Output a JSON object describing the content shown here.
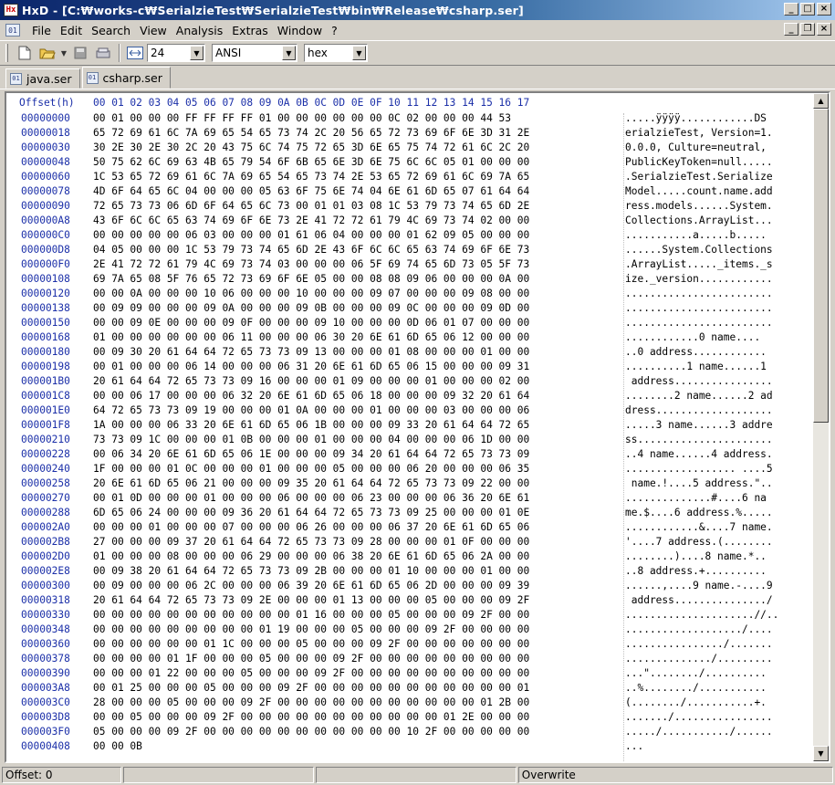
{
  "window": {
    "title": "HxD - [C:₩works-c₩SerialzieTest₩SerialzieTest₩bin₩Release₩csharp.ser]",
    "app_icon_label": "Hx"
  },
  "menu": {
    "items": [
      "File",
      "Edit",
      "Search",
      "View",
      "Analysis",
      "Extras",
      "Window",
      "?"
    ]
  },
  "toolbar": {
    "bytes_per_row": "24",
    "charset": "ANSI",
    "display_mode": "hex"
  },
  "tabs": [
    {
      "label": "java.ser",
      "active": false
    },
    {
      "label": "csharp.ser",
      "active": true
    }
  ],
  "editor": {
    "offset_header": "Offset(h)",
    "column_header": "00 01 02 03 04 05 06 07 08 09 0A 0B 0C 0D 0E 0F 10 11 12 13 14 15 16 17",
    "rows": [
      {
        "offset": "00000000",
        "hex": "00 01 00 00 00 FF FF FF FF 01 00 00 00 00 00 00 0C 02 00 00 00 44 53",
        "text": ".....ÿÿÿÿ............DS"
      },
      {
        "offset": "00000018",
        "hex": "65 72 69 61 6C 7A 69 65 54 65 73 74 2C 20 56 65 72 73 69 6F 6E 3D 31 2E",
        "text": "erialzieTest, Version=1."
      },
      {
        "offset": "00000030",
        "hex": "30 2E 30 2E 30 2C 20 43 75 6C 74 75 72 65 3D 6E 65 75 74 72 61 6C 2C 20",
        "text": "0.0.0, Culture=neutral, "
      },
      {
        "offset": "00000048",
        "hex": "50 75 62 6C 69 63 4B 65 79 54 6F 6B 65 6E 3D 6E 75 6C 6C 05 01 00 00 00",
        "text": "PublicKeyToken=null....."
      },
      {
        "offset": "00000060",
        "hex": "1C 53 65 72 69 61 6C 7A 69 65 54 65 73 74 2E 53 65 72 69 61 6C 69 7A 65",
        "text": ".SerialzieTest.Serialize"
      },
      {
        "offset": "00000078",
        "hex": "4D 6F 64 65 6C 04 00 00 00 05 63 6F 75 6E 74 04 6E 61 6D 65 07 61 64 64",
        "text": "Model.....count.name.add"
      },
      {
        "offset": "00000090",
        "hex": "72 65 73 73 06 6D 6F 64 65 6C 73 00 01 01 03 08 1C 53 79 73 74 65 6D 2E",
        "text": "ress.models......System."
      },
      {
        "offset": "000000A8",
        "hex": "43 6F 6C 6C 65 63 74 69 6F 6E 73 2E 41 72 72 61 79 4C 69 73 74 02 00 00",
        "text": "Collections.ArrayList..."
      },
      {
        "offset": "000000C0",
        "hex": "00 00 00 00 00 06 03 00 00 00 01 61 06 04 00 00 00 01 62 09 05 00 00 00",
        "text": "...........a.....b....."
      },
      {
        "offset": "000000D8",
        "hex": "04 05 00 00 00 1C 53 79 73 74 65 6D 2E 43 6F 6C 6C 65 63 74 69 6F 6E 73",
        "text": "......System.Collections"
      },
      {
        "offset": "000000F0",
        "hex": "2E 41 72 72 61 79 4C 69 73 74 03 00 00 00 06 5F 69 74 65 6D 73 05 5F 73",
        "text": ".ArrayList....._items._s"
      },
      {
        "offset": "00000108",
        "hex": "69 7A 65 08 5F 76 65 72 73 69 6F 6E 05 00 00 08 08 09 06 00 00 00 0A 00",
        "text": "ize._version............"
      },
      {
        "offset": "00000120",
        "hex": "00 00 0A 00 00 00 10 06 00 00 00 10 00 00 00 09 07 00 00 00 09 08 00 00",
        "text": "........................"
      },
      {
        "offset": "00000138",
        "hex": "00 09 09 00 00 00 09 0A 00 00 00 09 0B 00 00 00 09 0C 00 00 00 09 0D 00",
        "text": "........................"
      },
      {
        "offset": "00000150",
        "hex": "00 00 09 0E 00 00 00 09 0F 00 00 00 09 10 00 00 00 0D 06 01 07 00 00 00",
        "text": "........................"
      },
      {
        "offset": "00000168",
        "hex": "01 00 00 00 00 00 00 06 11 00 00 00 06 30 20 6E 61 6D 65 06 12 00 00 00",
        "text": "............0 name...."
      },
      {
        "offset": "00000180",
        "hex": "00 09 30 20 61 64 64 72 65 73 73 09 13 00 00 00 01 08 00 00 00 01 00 00",
        "text": "..0 address............"
      },
      {
        "offset": "00000198",
        "hex": "00 01 00 00 00 06 14 00 00 00 06 31 20 6E 61 6D 65 06 15 00 00 00 09 31",
        "text": "..........1 name......1"
      },
      {
        "offset": "000001B0",
        "hex": "20 61 64 64 72 65 73 73 09 16 00 00 00 01 09 00 00 00 01 00 00 00 02 00",
        "text": " address................"
      },
      {
        "offset": "000001C8",
        "hex": "00 00 06 17 00 00 00 06 32 20 6E 61 6D 65 06 18 00 00 00 09 32 20 61 64",
        "text": "........2 name......2 ad"
      },
      {
        "offset": "000001E0",
        "hex": "64 72 65 73 73 09 19 00 00 00 01 0A 00 00 00 01 00 00 00 03 00 00 00 06",
        "text": "dress..................."
      },
      {
        "offset": "000001F8",
        "hex": "1A 00 00 00 06 33 20 6E 61 6D 65 06 1B 00 00 00 09 33 20 61 64 64 72 65",
        "text": ".....3 name......3 addre"
      },
      {
        "offset": "00000210",
        "hex": "73 73 09 1C 00 00 00 01 0B 00 00 00 01 00 00 00 04 00 00 00 06 1D 00 00",
        "text": "ss......................"
      },
      {
        "offset": "00000228",
        "hex": "00 06 34 20 6E 61 6D 65 06 1E 00 00 00 09 34 20 61 64 64 72 65 73 73 09",
        "text": "..4 name......4 address."
      },
      {
        "offset": "00000240",
        "hex": "1F 00 00 00 01 0C 00 00 00 01 00 00 00 05 00 00 00 06 20 00 00 00 06 35",
        "text": ".................. ....5"
      },
      {
        "offset": "00000258",
        "hex": "20 6E 61 6D 65 06 21 00 00 00 09 35 20 61 64 64 72 65 73 73 09 22 00 00",
        "text": " name.!....5 address.\".."
      },
      {
        "offset": "00000270",
        "hex": "00 01 0D 00 00 00 01 00 00 00 06 00 00 00 06 23 00 00 00 06 36 20 6E 61",
        "text": "..............#....6 na"
      },
      {
        "offset": "00000288",
        "hex": "6D 65 06 24 00 00 00 09 36 20 61 64 64 72 65 73 73 09 25 00 00 00 01 0E",
        "text": "me.$....6 address.%....."
      },
      {
        "offset": "000002A0",
        "hex": "00 00 00 01 00 00 00 07 00 00 00 06 26 00 00 00 06 37 20 6E 61 6D 65 06",
        "text": "............&....7 name."
      },
      {
        "offset": "000002B8",
        "hex": "27 00 00 00 09 37 20 61 64 64 72 65 73 73 09 28 00 00 00 01 0F 00 00 00",
        "text": "'....7 address.(........"
      },
      {
        "offset": "000002D0",
        "hex": "01 00 00 00 08 00 00 00 06 29 00 00 00 06 38 20 6E 61 6D 65 06 2A 00 00",
        "text": "........)....8 name.*.."
      },
      {
        "offset": "000002E8",
        "hex": "00 09 38 20 61 64 64 72 65 73 73 09 2B 00 00 00 01 10 00 00 00 01 00 00",
        "text": "..8 address.+.........."
      },
      {
        "offset": "00000300",
        "hex": "00 09 00 00 00 06 2C 00 00 00 06 39 20 6E 61 6D 65 06 2D 00 00 00 09 39",
        "text": "......,....9 name.-....9"
      },
      {
        "offset": "00000318",
        "hex": "20 61 64 64 72 65 73 73 09 2E 00 00 00 01 13 00 00 00 05 00 00 00 09 2F",
        "text": " address.............../"
      },
      {
        "offset": "00000330",
        "hex": "00 00 00 00 00 00 00 00 00 00 00 01 16 00 00 00 05 00 00 00 09 2F 00 00",
        "text": ".....................//.."
      },
      {
        "offset": "00000348",
        "hex": "00 00 00 00 00 00 00 00 00 01 19 00 00 00 05 00 00 00 09 2F 00 00 00 00",
        "text": ".................../...."
      },
      {
        "offset": "00000360",
        "hex": "00 00 00 00 00 00 01 1C 00 00 00 05 00 00 00 09 2F 00 00 00 00 00 00 00",
        "text": "................/......."
      },
      {
        "offset": "00000378",
        "hex": "00 00 00 00 01 1F 00 00 00 05 00 00 00 09 2F 00 00 00 00 00 00 00 00 00",
        "text": "............../........."
      },
      {
        "offset": "00000390",
        "hex": "00 00 00 01 22 00 00 00 05 00 00 00 09 2F 00 00 00 00 00 00 00 00 00 00",
        "text": "...\"......../.........."
      },
      {
        "offset": "000003A8",
        "hex": "00 01 25 00 00 00 05 00 00 00 09 2F 00 00 00 00 00 00 00 00 00 00 00 01",
        "text": "..%......../..........."
      },
      {
        "offset": "000003C0",
        "hex": "28 00 00 00 05 00 00 00 09 2F 00 00 00 00 00 00 00 00 00 00 00 01 2B 00",
        "text": "(......../...........+."
      },
      {
        "offset": "000003D8",
        "hex": "00 00 05 00 00 00 09 2F 00 00 00 00 00 00 00 00 00 00 00 01 2E 00 00 00",
        "text": "......./................"
      },
      {
        "offset": "000003F0",
        "hex": "05 00 00 00 09 2F 00 00 00 00 00 00 00 00 00 00 00 10 2F 00 00 00 00 00",
        "text": "...../.........../......"
      },
      {
        "offset": "00000408",
        "hex": "00 00 0B",
        "text": "..."
      }
    ]
  },
  "status": {
    "offset": "Offset: 0",
    "mode": "Overwrite"
  }
}
